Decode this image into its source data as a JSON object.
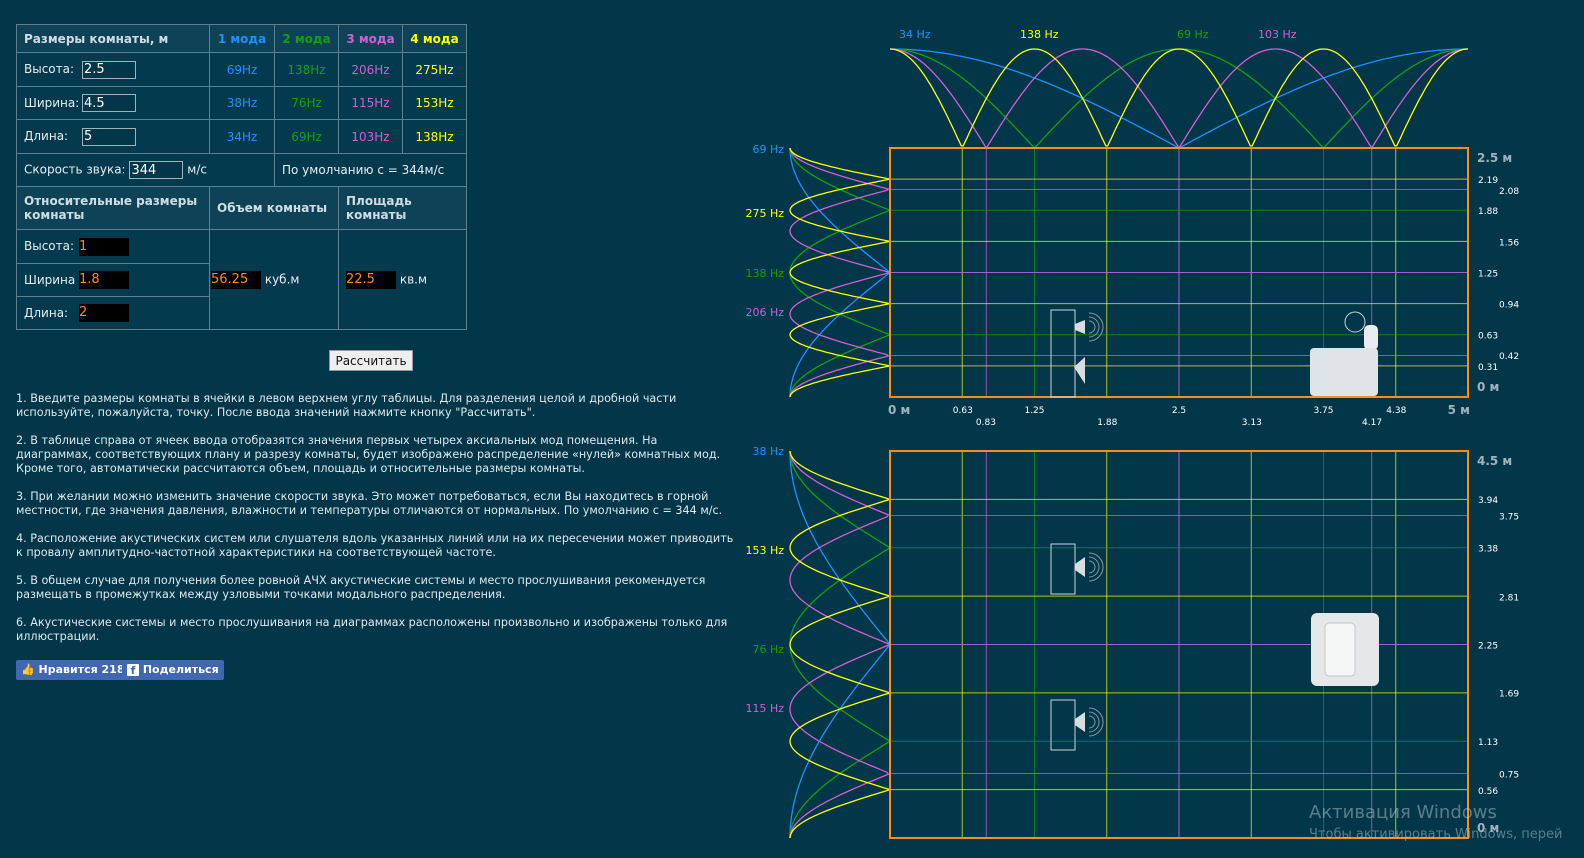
{
  "table": {
    "title": "Размеры комнаты, м",
    "mode_headers": [
      "1 мода",
      "2 мода",
      "3 мода",
      "4 мода"
    ],
    "mode_colors": [
      "#1e90ff",
      "#11a011",
      "#d25fd2",
      "#ffff00"
    ],
    "rows": [
      {
        "label": "Высота:",
        "value": "2.5",
        "freqs": [
          "69Hz",
          "138Hz",
          "206Hz",
          "275Hz"
        ]
      },
      {
        "label": "Ширина:",
        "value": "4.5",
        "freqs": [
          "38Hz",
          "76Hz",
          "115Hz",
          "153Hz"
        ]
      },
      {
        "label": "Длина:",
        "value": "5",
        "freqs": [
          "34Hz",
          "69Hz",
          "103Hz",
          "138Hz"
        ]
      }
    ],
    "speed_label": "Скорость звука:",
    "speed_value": "344",
    "speed_unit": "м/с",
    "speed_default": "По  умолчанию с = 344м/с",
    "rel_title": "Относительные размеры комнаты",
    "volume_title": "Объем комнаты",
    "area_title": "Площадь комнаты",
    "rel_rows": [
      {
        "label": "Высота:",
        "value": "1"
      },
      {
        "label": "Ширина",
        "value": "1.8"
      },
      {
        "label": "Длина:",
        "value": "2"
      }
    ],
    "volume_value": "56.25",
    "volume_unit": "куб.м",
    "area_value": "22.5",
    "area_unit": "кв.м"
  },
  "calc_button": "Рассчитать",
  "notes": [
    "1. Введите размеры комнаты в ячейки в левом верхнем углу таблицы. Для разделения целой и дробной части используйте, пожалуйста, точку. После ввода значений нажмите кнопку \"Рассчитать\".",
    "2. В таблице справа от ячеек ввода отобразятся значения первых четырех аксиальных мод помещения. На диаграммах, соответствующих плану и разрезу комнаты, будет изображено распределение «нулей» комнатных мод. Кроме того, автоматически рассчитаются объем, площадь и относительные размеры комнаты.",
    "3. При желании можно изменить значение скорости звука. Это может потребоваться, если Вы находитесь в горной местности, где значения давления, влажности и температуры отличаются от нормальных. По умолчанию с = 344 м/с.",
    "4. Расположение акустических систем или слушателя вдоль указанных линий или на их пересечении может приводить к провалу амплитудно-частотной характеристики на соответствующей частоте.",
    "5. В общем случае для получения более ровной АЧХ акустические системы и место прослушивания рекомендуется размещать в промежутках между узловыми точками модального распределения.",
    "6. Акустические системы и место прослушивания на диаграммах расположены произвольно и изображены только для иллюстрации."
  ],
  "social": {
    "like": "Нравится 218",
    "share": "Поделиться"
  },
  "diagrams": {
    "length": 5,
    "height": 2.5,
    "width": 4.5,
    "length_modes": [
      {
        "n": 1,
        "label": "34 Hz",
        "color": "#1e90ff"
      },
      {
        "n": 2,
        "label": "69 Hz",
        "color": "#11a011"
      },
      {
        "n": 3,
        "label": "103 Hz",
        "color": "#d25fd2"
      },
      {
        "n": 4,
        "label": "138 Hz",
        "color": "#ffff00"
      }
    ],
    "height_modes": [
      {
        "n": 1,
        "label": "69 Hz",
        "color": "#1e90ff"
      },
      {
        "n": 2,
        "label": "138 Hz",
        "color": "#11a011"
      },
      {
        "n": 3,
        "label": "206 Hz",
        "color": "#d25fd2"
      },
      {
        "n": 4,
        "label": "275 Hz",
        "color": "#ffff00"
      }
    ],
    "width_modes": [
      {
        "n": 1,
        "label": "38 Hz",
        "color": "#1e90ff"
      },
      {
        "n": 2,
        "label": "76 Hz",
        "color": "#11a011"
      },
      {
        "n": 3,
        "label": "115 Hz",
        "color": "#d25fd2"
      },
      {
        "n": 4,
        "label": "153 Hz",
        "color": "#ffff00"
      }
    ],
    "x_ticks": [
      "0.63",
      "0.83",
      "1.25",
      "1.88",
      "2.5",
      "3.13",
      "3.75",
      "4.17",
      "4.38"
    ],
    "x_start": "0 м",
    "x_end": "5 м",
    "h_ticks": [
      "2.19",
      "2.08",
      "1.88",
      "1.56",
      "1.25",
      "0.94",
      "0.63",
      "0.42",
      "0.31"
    ],
    "h_top": "2.5 м",
    "h_zero": "0 м",
    "w_ticks": [
      "3.94",
      "3.75",
      "3.38",
      "2.81",
      "2.25",
      "1.69",
      "1.13",
      "0.75",
      "0.56"
    ],
    "w_top": "4.5 м",
    "w_zero": "0 м"
  },
  "watermark": {
    "title": "Активация Windows",
    "sub": "Чтобы активировать Windows, перей"
  }
}
